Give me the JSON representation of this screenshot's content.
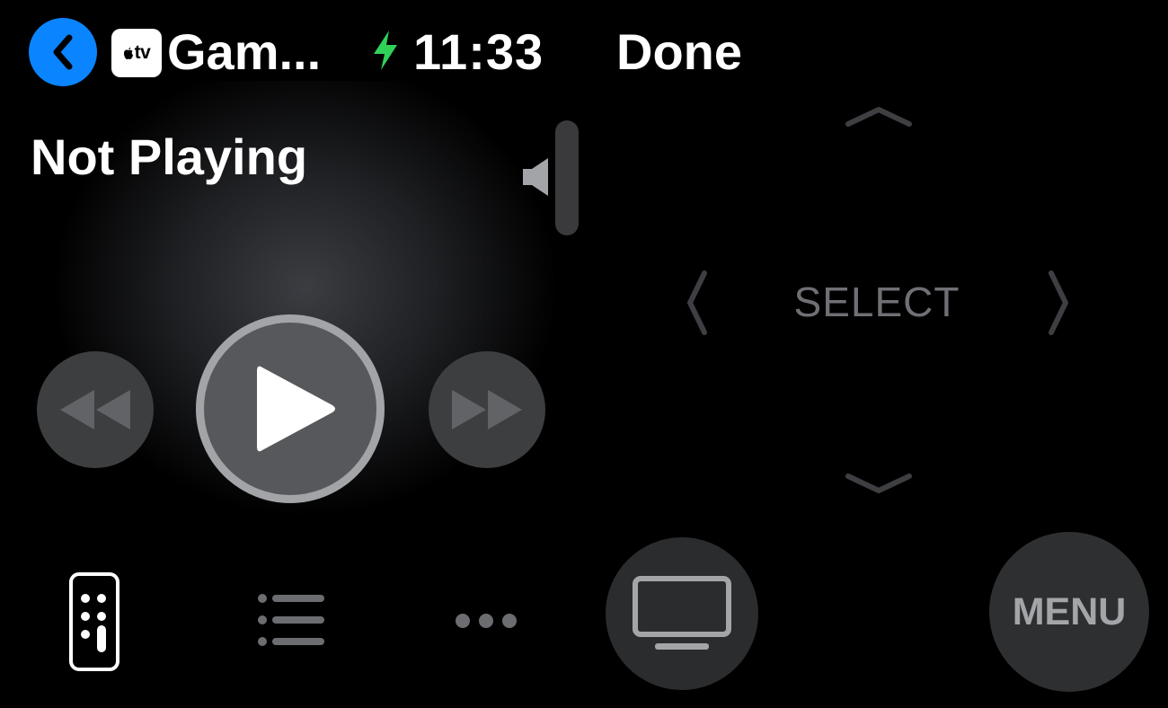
{
  "status_bar": {
    "app_badge": "tv",
    "app_title": "Gam...",
    "time": "11:33",
    "done_label": "Done"
  },
  "now_playing": {
    "title": "Not Playing"
  },
  "dpad": {
    "select_label": "SELECT"
  },
  "buttons": {
    "menu_label": "MENU"
  },
  "icons": {
    "back": "chevron-left-icon",
    "charging": "lightning-bolt-icon",
    "volume": "speaker-icon",
    "rewind": "rewind-icon",
    "play": "play-icon",
    "fast_forward": "fast-forward-icon",
    "remote": "remote-icon",
    "list": "list-icon",
    "more": "ellipsis-icon",
    "tv": "tv-icon"
  },
  "colors": {
    "accent": "#0a84ff",
    "charging": "#30d158"
  }
}
